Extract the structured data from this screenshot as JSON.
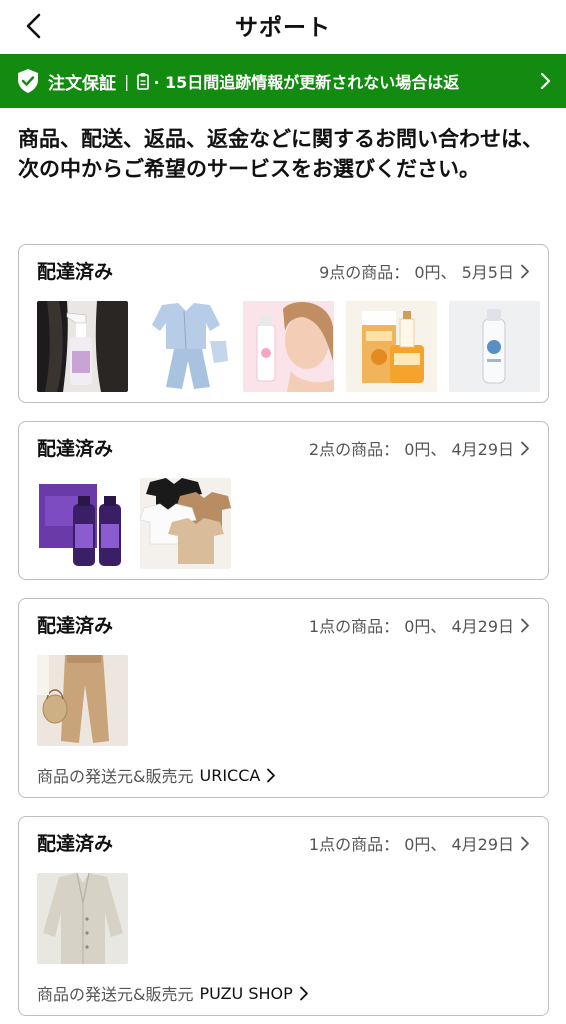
{
  "header": {
    "title": "サポート",
    "back_icon": "chevron-left-icon"
  },
  "banner": {
    "title": "注文保証",
    "separator": "|",
    "text": "· 15日間追跡情報が更新されない場合は返",
    "background": "#138a10",
    "icons": [
      "shield-check-icon",
      "clipboard-icon",
      "chevron-right-icon"
    ]
  },
  "intro": "商品、配送、返品、返金などに関するお問い合わせは、次の中からご希望のサービスをお選びください。",
  "orders": [
    {
      "status": "配達済み",
      "summary": "9点の商品： 0円、 5月5日",
      "thumbs": [
        "hair-spray-product-image",
        "pajama-set-image",
        "face-mist-image",
        "bee-venom-cream-image",
        "spray-bottle-image"
      ],
      "seller_label": "",
      "seller_name": ""
    },
    {
      "status": "配達済み",
      "summary": "2点の商品： 0円、 4月29日",
      "thumbs": [
        "purple-shampoo-image",
        "kids-tshirts-image"
      ],
      "seller_label": "",
      "seller_name": ""
    },
    {
      "status": "配達済み",
      "summary": "1点の商品： 0円、 4月29日",
      "thumbs": [
        "beige-pants-image"
      ],
      "seller_label": "商品の発送元&販売元",
      "seller_name": "URICCA"
    },
    {
      "status": "配達済み",
      "summary": "1点の商品： 0円、 4月29日",
      "thumbs": [
        "linen-coat-image"
      ],
      "seller_label": "商品の発送元&販売元",
      "seller_name": "PUZU SHOP"
    }
  ]
}
